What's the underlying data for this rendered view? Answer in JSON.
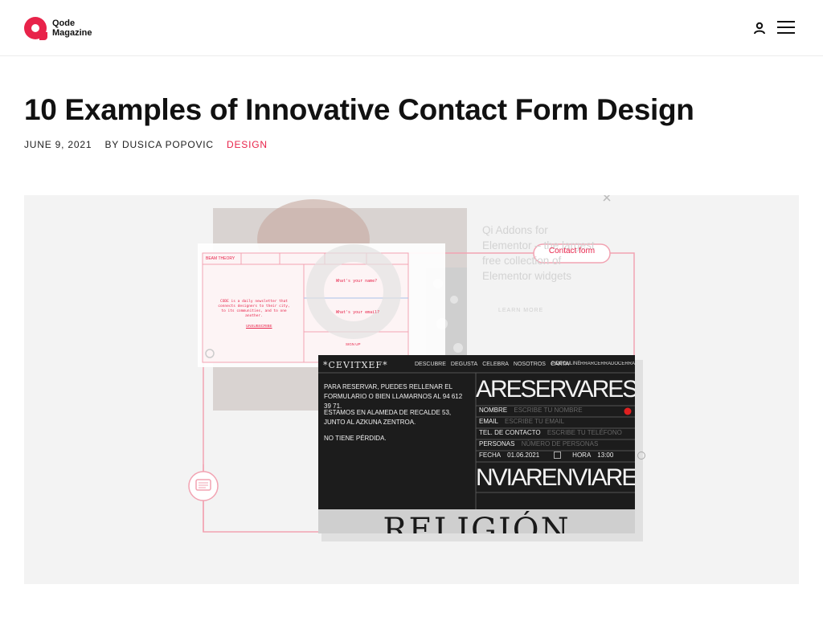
{
  "header": {
    "logo_line1": "Qode",
    "logo_line2": "Magazine",
    "icons": {
      "user": "user-icon",
      "menu": "hamburger-menu-icon"
    }
  },
  "article": {
    "title": "10 Examples of Innovative Contact Form Design",
    "date": "JUNE 9, 2021",
    "author": "BY DUSICA POPOVIC",
    "category": "DESIGN"
  },
  "hero": {
    "promo_text": "Qi Addons for Elementor – the largest free collection of Elementor widgets",
    "contact_pill": "Contact form",
    "learn_more": "LEARN MORE",
    "form_card": {
      "nav": "BEAM THEORY",
      "name_question": "What's your name?",
      "email_question": "What's your email?",
      "sign_up": "SIGN UP",
      "unsubscribe": "UNSUBSCRIBE",
      "blurb": "CODE is a daily newsletter that connects designers to their city, to its communities, and to one another."
    },
    "dark_card": {
      "brand": "*CEVITXEF*",
      "nav": [
        "DESCUBRE",
        "DEGUSTA",
        "CELEBRA",
        "NOSOTROS",
        "CARTA"
      ],
      "nav_right": "PIDEONLINE",
      "nav_right2": "RRARCERRADOCERRAD",
      "intro": "PARA RESERVAR, PUEDES RELLENAR EL FORMULARIO O BIEN LLAMARNOS AL 94 612 39 71.",
      "address": "ESTAMOS EN ALAMEDA DE RECALDE 53, JUNTO AL AZKUNA ZENTROA.",
      "lost": "NO TIENE PÉRDIDA.",
      "reserva_marquee": "ARESERVARESERVARES",
      "fields": [
        {
          "label": "NOMBRE",
          "placeholder": "ESCRIBE TU NOMBRE"
        },
        {
          "label": "EMAIL",
          "placeholder": "ESCRIBE TU EMAIL"
        },
        {
          "label": "TEL. DE CONTACTO",
          "placeholder": "ESCRIBE TU TELÉFONO"
        },
        {
          "label": "PERSONAS",
          "placeholder": "NÚMERO DE PERSONAS"
        }
      ],
      "fecha_label": "FECHA",
      "fecha_value": "01.06.2021",
      "hora_label": "HORA",
      "hora_value": "13:00",
      "enviar_marquee": "NVIARENVIARENVIARE",
      "bottom_word": "RELIGIÓN"
    }
  }
}
